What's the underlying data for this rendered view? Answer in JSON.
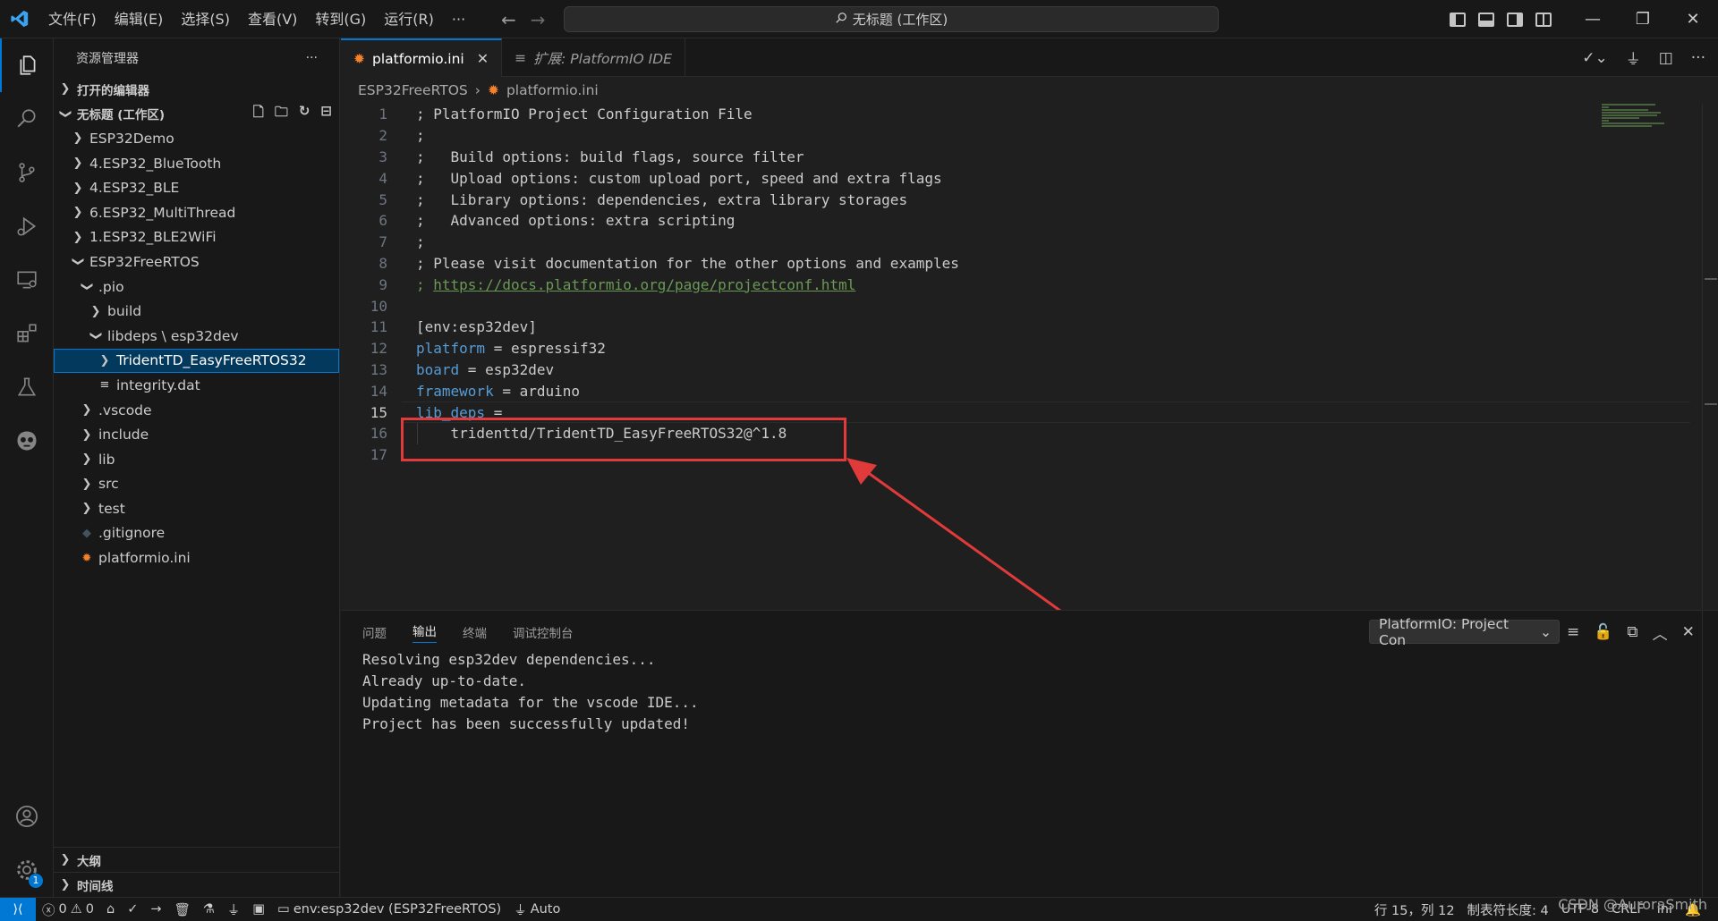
{
  "titlebar": {
    "menus": [
      "文件(F)",
      "编辑(E)",
      "选择(S)",
      "查看(V)",
      "转到(G)",
      "运行(R)",
      "···"
    ],
    "search_text": "无标题 (工作区)"
  },
  "sidebar": {
    "title": "资源管理器",
    "more": "···",
    "open_editors": "打开的编辑器",
    "workspace": "无标题 (工作区)",
    "tree": [
      {
        "label": "ESP32Demo"
      },
      {
        "label": "4.ESP32_BlueTooth"
      },
      {
        "label": "4.ESP32_BLE"
      },
      {
        "label": "6.ESP32_MultiThread"
      },
      {
        "label": "1.ESP32_BLE2WiFi"
      },
      {
        "label": "ESP32FreeRTOS"
      },
      {
        "label": ".pio"
      },
      {
        "label": "build"
      },
      {
        "label": "libdeps \\ esp32dev"
      },
      {
        "label": "TridentTD_EasyFreeRTOS32"
      },
      {
        "label": "integrity.dat"
      },
      {
        "label": ".vscode"
      },
      {
        "label": "include"
      },
      {
        "label": "lib"
      },
      {
        "label": "src"
      },
      {
        "label": "test"
      },
      {
        "label": ".gitignore"
      },
      {
        "label": "platformio.ini"
      }
    ],
    "outline": "大纲",
    "timeline": "时间线"
  },
  "tabs": [
    {
      "label": "platformio.ini",
      "close": "✕"
    },
    {
      "label": "扩展: PlatformIO IDE"
    }
  ],
  "breadcrumb": {
    "folder": "ESP32FreeRTOS",
    "sep": "›",
    "file": "platformio.ini"
  },
  "editor": {
    "lines": [
      {
        "n": "1",
        "text": "; PlatformIO Project Configuration File"
      },
      {
        "n": "2",
        "text": ";"
      },
      {
        "n": "3",
        "text": ";   Build options: build flags, source filter"
      },
      {
        "n": "4",
        "text": ";   Upload options: custom upload port, speed and extra flags"
      },
      {
        "n": "5",
        "text": ";   Library options: dependencies, extra library storages"
      },
      {
        "n": "6",
        "text": ";   Advanced options: extra scripting"
      },
      {
        "n": "7",
        "text": ";"
      },
      {
        "n": "8",
        "text": "; Please visit documentation for the other options and examples"
      },
      {
        "n": "9",
        "prefix": "; ",
        "link": "https://docs.platformio.org/page/projectconf.html"
      },
      {
        "n": "10",
        "text": ""
      },
      {
        "n": "11",
        "section": "[env:esp32dev]"
      },
      {
        "n": "12",
        "key": "platform",
        "value": " = espressif32"
      },
      {
        "n": "13",
        "key": "board",
        "value": " = esp32dev"
      },
      {
        "n": "14",
        "key": "framework",
        "value": " = arduino"
      },
      {
        "n": "15",
        "key": "lib_deps",
        "value": " ="
      },
      {
        "n": "16",
        "text": "    tridenttd/TridentTD_EasyFreeRTOS32@^1.8"
      },
      {
        "n": "17",
        "text": ""
      }
    ],
    "current_line": "15"
  },
  "panel": {
    "tabs": [
      "问题",
      "输出",
      "终端",
      "调试控制台"
    ],
    "channel": "PlatformIO: Project Con",
    "output": [
      "Resolving esp32dev dependencies...",
      "Already up-to-date.",
      "Updating metadata for the vscode IDE...",
      "Project has been successfully updated!"
    ]
  },
  "statusbar": {
    "errors": "0",
    "warnings": "0",
    "env": "env:esp32dev (ESP32FreeRTOS)",
    "auto": "Auto",
    "position": "行 15，列 12",
    "tabsize": "制表符长度: 4",
    "encoding": "UTF-8",
    "eol": "CRLF",
    "lang": "ini"
  },
  "watermark": "CSDN @AuroraSmith",
  "settings_badge": "1"
}
